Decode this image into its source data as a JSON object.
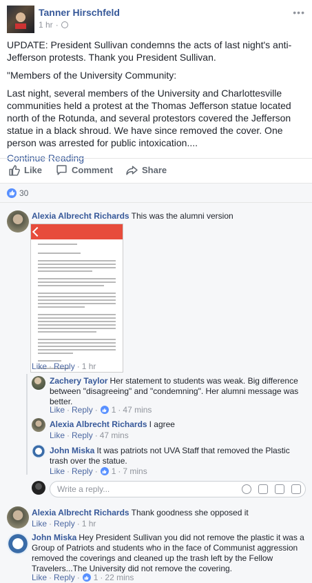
{
  "post": {
    "author": "Tanner Hirschfeld",
    "time": "1 hr",
    "dot": "·",
    "paragraph1": "UPDATE: President Sullivan condemns the acts of last night's anti-Jefferson protests. Thank you President Sullivan.",
    "paragraph2": "\"Members of the University Community:",
    "paragraph3": "Last night, several members of the University and Charlottesville communities held a protest at the Thomas Jefferson statue located north of the Rotunda, and several protestors covered the Jefferson statue in a black shroud. We have since removed the cover. One person was arrested for public intoxication....",
    "continue_label": "Continue Reading"
  },
  "actions": {
    "like": "Like",
    "comment": "Comment",
    "share": "Share"
  },
  "reactions": {
    "count": "30"
  },
  "comments": [
    {
      "name": "Alexia Albrecht Richards",
      "text": "This was the alumni version",
      "like": "Like",
      "reply": "Reply",
      "time": "1 hr"
    },
    {
      "name": "Zachery Taylor",
      "text": "Her statement to students was weak. Big difference between \"disagreeing\" and \"condemning\". Her alumni message was better.",
      "like": "Like",
      "reply": "Reply",
      "likes": "1",
      "time": "47 mins"
    },
    {
      "name": "Alexia Albrecht Richards",
      "text": "I agree",
      "like": "Like",
      "reply": "Reply",
      "time": "47 mins"
    },
    {
      "name": "John Miska",
      "text": "It was patriots not UVA Staff that removed the Plastic trash over the statue.",
      "like": "Like",
      "reply": "Reply",
      "likes": "1",
      "time": "7 mins"
    },
    {
      "name": "Alexia Albrecht Richards",
      "text": "Thank goodness she opposed it",
      "like": "Like",
      "reply": "Reply",
      "time": "1 hr"
    },
    {
      "name": "John Miska",
      "text": "Hey President Sullivan you did not remove the plastic it was a Group of Patriots and students who in the face of Communist aggression removed the coverings and cleaned up the trash left by the Fellow Travelers...The University did not remove the covering.",
      "like": "Like",
      "reply": "Reply",
      "likes": "1",
      "time": "22 mins"
    }
  ],
  "reply_box": {
    "placeholder": "Write a reply..."
  },
  "sep": "·",
  "colors": {
    "link": "#365899",
    "like_blue": "#5890ff",
    "background": "#f6f7f9"
  }
}
